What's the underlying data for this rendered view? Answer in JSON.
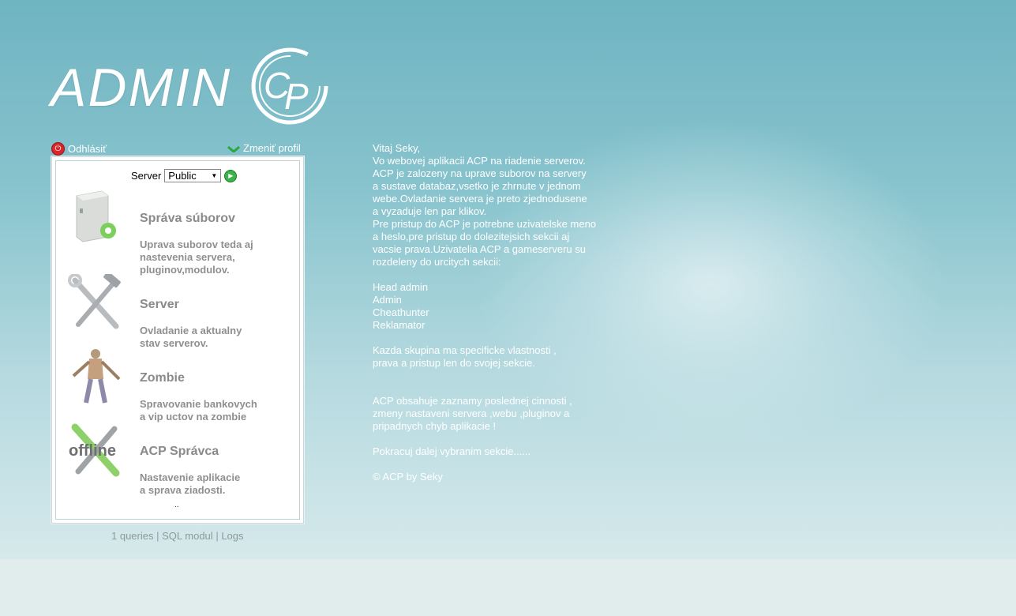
{
  "logo": {
    "text": "ADMIN",
    "mark": "CP"
  },
  "links": {
    "logout": "Odhlásiť",
    "profile": "Zmeniť profil"
  },
  "server": {
    "label": "Server",
    "selected": "Public"
  },
  "sections": [
    {
      "title": "Správa súborov",
      "desc1": "Uprava suborov teda aj",
      "desc2": "nastevenia servera,",
      "desc3": "pluginov,modulov."
    },
    {
      "title": "Server",
      "desc1": "Ovladanie a aktualny",
      "desc2": "stav serverov."
    },
    {
      "title": "Zombie",
      "desc1": "Spravovanie bankovych",
      "desc2": "a vip uctov na zombie"
    },
    {
      "title": "ACP Správca",
      "desc1": "Nastavenie aplikacie",
      "desc2": "a sprava ziadosti."
    }
  ],
  "panel_more": "..",
  "footer": {
    "queries": "1 queries",
    "sep1": "|",
    "sql": "SQL modul",
    "sep2": "|",
    "logs": "Logs"
  },
  "welcome": {
    "lines1": [
      "Vitaj Seky,",
      "Vo webovej aplikacii ACP na riadenie serverov.",
      "ACP je zalozeny na uprave suborov na servery",
      "a sustave databaz,vsetko je zhrnute v jednom",
      "webe.Ovladanie servera je preto zjednodusene",
      "a vyzaduje len par klikov.",
      "Pre pristup do ACP je potrebne uzivatelske meno",
      "a heslo,pre pristup do dolezitejsich sekcii aj",
      "vacsie prava.Uzivatelia ACP a gameserveru su",
      "rozdeleny do urcitych sekcii:"
    ],
    "roles": [
      "Head admin",
      "Admin",
      "Cheathunter",
      "Reklamator"
    ],
    "lines2": [
      "Kazda skupina ma specificke vlastnosti ,",
      "prava a pristup len do svojej sekcie."
    ],
    "lines3": [
      "ACP obsahuje zaznamy poslednej cinnosti ,",
      "zmeny nastaveni servera ,webu ,pluginov a",
      "pripadnych chyb aplikacie !"
    ],
    "continue": "Pokracuj dalej vybranim sekcie......",
    "copyright": "© ACP by Seky"
  },
  "colors": {
    "accent_green": "#3bb34a",
    "logout_red": "#d8262b",
    "bg_top": "#6fb4c1"
  }
}
